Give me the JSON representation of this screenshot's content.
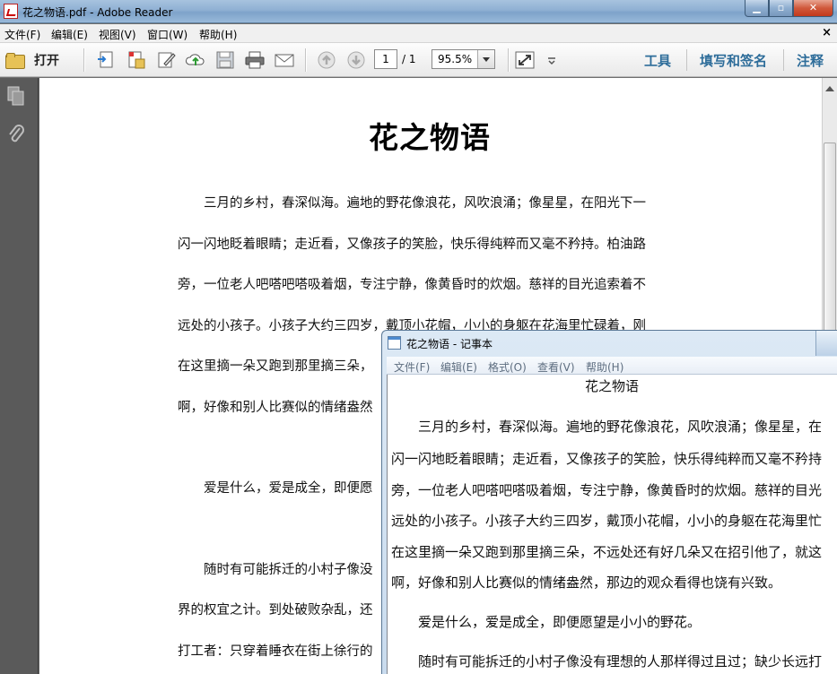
{
  "reader": {
    "window_title": "花之物语.pdf - Adobe Reader",
    "menu": [
      "文件(F)",
      "编辑(E)",
      "视图(V)",
      "窗口(W)",
      "帮助(H)"
    ],
    "menu_close": "×",
    "toolbar": {
      "open_label": "打开",
      "page_current": "1",
      "page_total": "/ 1",
      "zoom": "95.5%",
      "tools_label": "工具",
      "fill_sign_label": "填写和签名",
      "comment_label": "注释"
    },
    "document": {
      "title": "花之物语",
      "lines": [
        "　　三月的乡村，春深似海。遍地的野花像浪花，风吹浪涌；像星星，在阳光下一",
        "闪一闪地眨着眼睛；走近看，又像孩子的笑脸，快乐得纯粹而又毫不矜持。柏油路",
        "旁，一位老人吧嗒吧嗒吸着烟，专注宁静，像黄昏时的炊烟。慈祥的目光追索着不",
        "远处的小孩子。小孩子大约三四岁，戴顶小花帽，小小的身躯在花海里忙碌着，刚",
        "在这里摘一朵又跑到那里摘三朵，",
        "啊，好像和别人比赛似的情绪盎然",
        "　　爱是什么，爱是成全，即便愿",
        "　　随时有可能拆迁的小村子像没",
        "界的权宜之计。到处破败杂乱，还",
        "打工者：只穿着睡衣在街上徐行的"
      ]
    }
  },
  "notepad": {
    "window_title": "花之物语 - 记事本",
    "menu": [
      "文件(F)",
      "编辑(E)",
      "格式(O)",
      "查看(V)",
      "帮助(H)"
    ],
    "lines": [
      "花之物语",
      "　　三月的乡村，春深似海。遍地的野花像浪花，风吹浪涌；像星星，在",
      "闪一闪地眨着眼睛；走近看，又像孩子的笑脸，快乐得纯粹而又毫不矜持",
      "旁，一位老人吧嗒吧嗒吸着烟，专注宁静，像黄昏时的炊烟。慈祥的目光",
      "远处的小孩子。小孩子大约三四岁，戴顶小花帽，小小的身躯在花海里忙",
      "在这里摘一朵又跑到那里摘三朵，不远处还有好几朵又在招引他了，就这",
      "啊，好像和别人比赛似的情绪盎然，那边的观众看得也饶有兴致。",
      "　　爱是什么，爱是成全，即便愿望是小小的野花。",
      "　　随时有可能拆迁的小村子像没有理想的人那样得过且过；缺少长远打"
    ]
  },
  "colors": {
    "link_blue": "#2e6d9a",
    "nav_panel": "#5a5a5a",
    "close_red": "#c2381b"
  }
}
